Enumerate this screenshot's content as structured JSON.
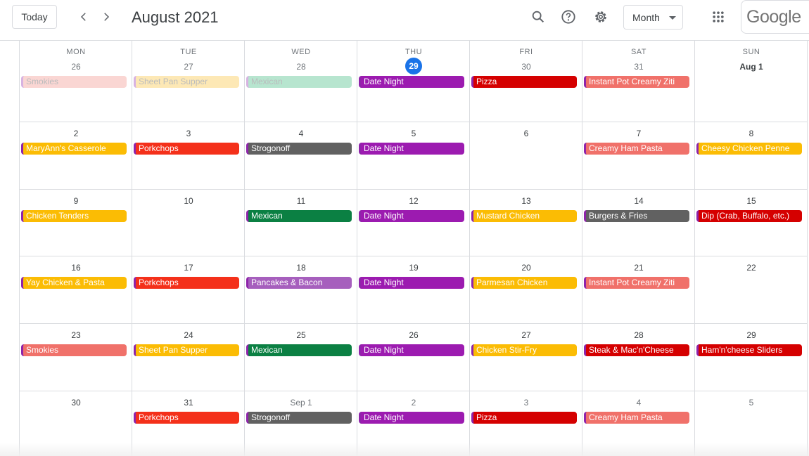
{
  "toolbar": {
    "today_label": "Today",
    "title": "August 2021",
    "view_label": "Month",
    "logo_text": "Google",
    "icons": [
      "chevron-left-icon",
      "chevron-right-icon",
      "search-icon",
      "help-icon",
      "settings-icon",
      "apps-icon"
    ]
  },
  "weekdays": [
    "MON",
    "TUE",
    "WED",
    "THU",
    "FRI",
    "SAT",
    "SUN"
  ],
  "weeks": [
    [
      {
        "day": "26",
        "muted": true,
        "event": {
          "title": "Smokies",
          "color": "#f28b82",
          "faded": true
        }
      },
      {
        "day": "27",
        "muted": true,
        "event": {
          "title": "Sheet Pan Supper",
          "color": "#fbc02d",
          "faded": true
        }
      },
      {
        "day": "28",
        "muted": true,
        "event": {
          "title": "Mexican",
          "color": "#33b679",
          "faded": true
        }
      },
      {
        "day": "29",
        "today": true,
        "event": {
          "title": "Date Night",
          "color": "#9c1bb0"
        }
      },
      {
        "day": "30",
        "muted": true,
        "event": {
          "title": "Pizza",
          "color": "#d50000"
        }
      },
      {
        "day": "31",
        "muted": true,
        "event": {
          "title": "Instant Pot Creamy Ziti",
          "color": "#f0716a"
        }
      },
      {
        "day": "Aug 1",
        "bold": true
      }
    ],
    [
      {
        "day": "2",
        "event": {
          "title": "MaryAnn's Casserole",
          "color": "#fbbc04"
        }
      },
      {
        "day": "3",
        "event": {
          "title": "Porkchops",
          "color": "#f4301a"
        }
      },
      {
        "day": "4",
        "event": {
          "title": "Strogonoff",
          "color": "#616161"
        }
      },
      {
        "day": "5",
        "event": {
          "title": "Date Night",
          "color": "#9c1bb0"
        }
      },
      {
        "day": "6"
      },
      {
        "day": "7",
        "event": {
          "title": "Creamy Ham Pasta",
          "color": "#f0716a"
        }
      },
      {
        "day": "8",
        "event": {
          "title": "Cheesy Chicken Penne",
          "color": "#fbbc04"
        }
      }
    ],
    [
      {
        "day": "9",
        "event": {
          "title": "Chicken Tenders",
          "color": "#fbbc04"
        }
      },
      {
        "day": "10"
      },
      {
        "day": "11",
        "event": {
          "title": "Mexican",
          "color": "#0b8043"
        }
      },
      {
        "day": "12",
        "event": {
          "title": "Date Night",
          "color": "#9c1bb0"
        }
      },
      {
        "day": "13",
        "event": {
          "title": "Mustard Chicken",
          "color": "#fbbc04"
        }
      },
      {
        "day": "14",
        "event": {
          "title": "Burgers & Fries",
          "color": "#616161"
        }
      },
      {
        "day": "15",
        "event": {
          "title": "Dip (Crab, Buffalo, etc.)",
          "color": "#d50000"
        }
      }
    ],
    [
      {
        "day": "16",
        "event": {
          "title": "Yay Chicken & Pasta",
          "color": "#fbbc04"
        }
      },
      {
        "day": "17",
        "event": {
          "title": "Porkchops",
          "color": "#f4301a"
        }
      },
      {
        "day": "18",
        "event": {
          "title": "Pancakes & Bacon",
          "color": "#a65fbd"
        }
      },
      {
        "day": "19",
        "event": {
          "title": "Date Night",
          "color": "#9c1bb0"
        }
      },
      {
        "day": "20",
        "event": {
          "title": "Parmesan Chicken",
          "color": "#fbbc04"
        }
      },
      {
        "day": "21",
        "event": {
          "title": "Instant Pot Creamy Ziti",
          "color": "#f0716a"
        }
      },
      {
        "day": "22"
      }
    ],
    [
      {
        "day": "23",
        "event": {
          "title": "Smokies",
          "color": "#f0716a"
        }
      },
      {
        "day": "24",
        "event": {
          "title": "Sheet Pan Supper",
          "color": "#fbbc04"
        }
      },
      {
        "day": "25",
        "event": {
          "title": "Mexican",
          "color": "#0b8043"
        }
      },
      {
        "day": "26",
        "event": {
          "title": "Date Night",
          "color": "#9c1bb0"
        }
      },
      {
        "day": "27",
        "event": {
          "title": "Chicken Stir-Fry",
          "color": "#fbbc04"
        }
      },
      {
        "day": "28",
        "event": {
          "title": "Steak & Mac'n'Cheese",
          "color": "#d50000"
        }
      },
      {
        "day": "29",
        "event": {
          "title": "Ham'n'cheese Sliders",
          "color": "#d50000"
        }
      }
    ],
    [
      {
        "day": "30"
      },
      {
        "day": "31",
        "event": {
          "title": "Porkchops",
          "color": "#f4301a"
        }
      },
      {
        "day": "Sep 1",
        "muted": true,
        "event": {
          "title": "Strogonoff",
          "color": "#616161"
        }
      },
      {
        "day": "2",
        "muted": true,
        "event": {
          "title": "Date Night",
          "color": "#9c1bb0"
        }
      },
      {
        "day": "3",
        "muted": true,
        "event": {
          "title": "Pizza",
          "color": "#d50000"
        }
      },
      {
        "day": "4",
        "muted": true,
        "event": {
          "title": "Creamy Ham Pasta",
          "color": "#f0716a"
        }
      },
      {
        "day": "5",
        "muted": true
      }
    ]
  ]
}
